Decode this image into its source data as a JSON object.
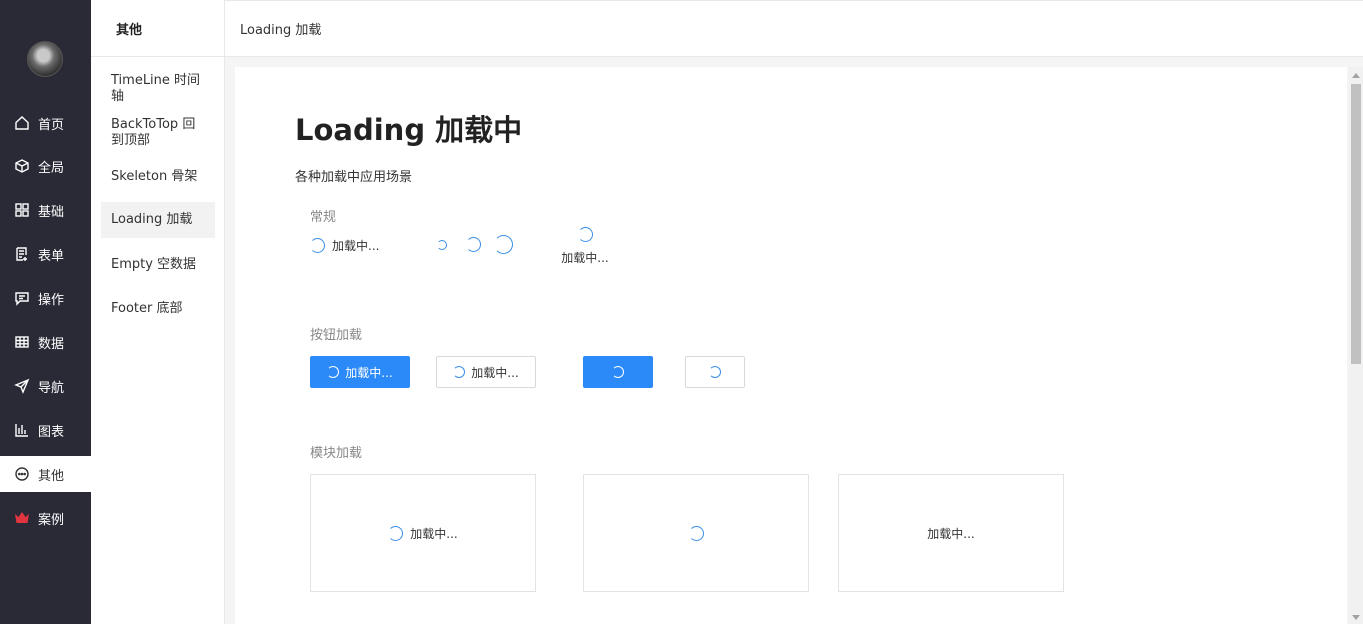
{
  "nav": {
    "items": [
      {
        "label": "首页",
        "icon": "home-icon"
      },
      {
        "label": "全局",
        "icon": "cube-icon"
      },
      {
        "label": "基础",
        "icon": "grid-icon"
      },
      {
        "label": "表单",
        "icon": "form-icon"
      },
      {
        "label": "操作",
        "icon": "chat-icon"
      },
      {
        "label": "数据",
        "icon": "table-icon"
      },
      {
        "label": "导航",
        "icon": "send-icon"
      },
      {
        "label": "图表",
        "icon": "bar-chart-icon"
      },
      {
        "label": "其他",
        "icon": "more-icon",
        "active": true
      },
      {
        "label": "案例",
        "icon": "crown-icon"
      }
    ]
  },
  "submenu": {
    "title": "其他",
    "items": [
      {
        "label": "TimeLine 时间轴"
      },
      {
        "label": "BackToTop 回到顶部"
      },
      {
        "label": "Skeleton 骨架"
      },
      {
        "label": "Loading 加载",
        "active": true
      },
      {
        "label": "Empty 空数据"
      },
      {
        "label": "Footer 底部"
      }
    ]
  },
  "header": {
    "breadcrumb": "Loading 加载"
  },
  "page": {
    "title": "Loading 加载中",
    "description": "各种加载中应用场景",
    "sections": {
      "normal": "常规",
      "button": "按钮加载",
      "block": "模块加载"
    },
    "loading_text": "加载中...",
    "button_loading_text": "加载中..."
  },
  "colors": {
    "nav_bg": "#292a36",
    "primary": "#2b8af7",
    "spinner": "#3a8ee6",
    "accent_red": "#e0353f"
  }
}
